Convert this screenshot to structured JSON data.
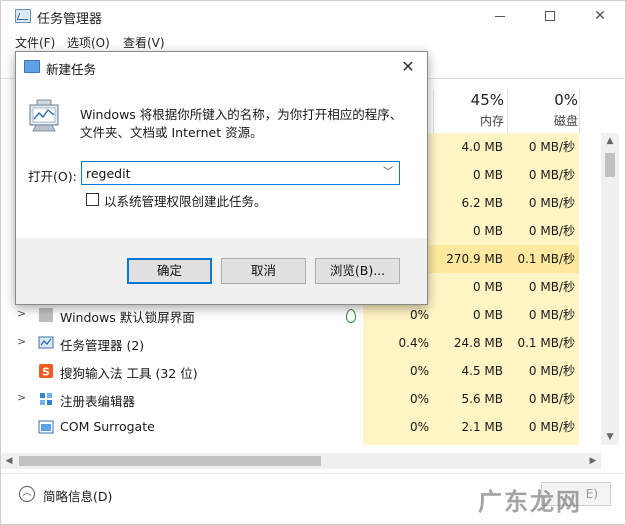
{
  "task_manager": {
    "title": "任务管理器",
    "menu": [
      "文件(F)",
      "选项(O)",
      "查看(V)"
    ],
    "columns": {
      "memory": {
        "percent": "45%",
        "label": "内存"
      },
      "disk": {
        "percent": "0%",
        "label": "磁盘"
      }
    },
    "rows": [
      {
        "name": "",
        "cpu": "",
        "mem": "4.0 MB",
        "disk": "0 MB/秒",
        "expand": false,
        "highlight": false
      },
      {
        "name": "",
        "cpu": "",
        "mem": "0 MB",
        "disk": "0 MB/秒",
        "expand": false,
        "highlight": false
      },
      {
        "name": "",
        "cpu": "",
        "mem": "6.2 MB",
        "disk": "0 MB/秒",
        "expand": false,
        "highlight": false
      },
      {
        "name": "",
        "cpu": "",
        "mem": "0 MB",
        "disk": "0 MB/秒",
        "expand": false,
        "highlight": false
      },
      {
        "name": "",
        "cpu": "",
        "mem": "270.9 MB",
        "disk": "0.1 MB/秒",
        "expand": false,
        "highlight": true
      },
      {
        "name": "",
        "cpu": "",
        "mem": "0 MB",
        "disk": "0 MB/秒",
        "expand": false,
        "highlight": false
      },
      {
        "name": "Windows 默认锁屏界面",
        "cpu": "0%",
        "mem": "0 MB",
        "disk": "0 MB/秒",
        "expand": true,
        "highlight": false,
        "icon": "gray-square-icon"
      },
      {
        "name": "任务管理器 (2)",
        "cpu": "0.4%",
        "mem": "24.8 MB",
        "disk": "0.1 MB/秒",
        "expand": true,
        "highlight": false,
        "icon": "task-manager-icon"
      },
      {
        "name": "搜狗输入法 工具 (32 位)",
        "cpu": "0%",
        "mem": "4.5 MB",
        "disk": "0 MB/秒",
        "expand": false,
        "highlight": false,
        "icon": "sogou-icon"
      },
      {
        "name": "注册表编辑器",
        "cpu": "0%",
        "mem": "5.6 MB",
        "disk": "0 MB/秒",
        "expand": true,
        "highlight": false,
        "icon": "regedit-icon"
      },
      {
        "name": "COM Surrogate",
        "cpu": "0%",
        "mem": "2.1 MB",
        "disk": "0 MB/秒",
        "expand": false,
        "highlight": false,
        "icon": "com-surrogate-icon"
      }
    ],
    "footer": {
      "details_label": "简略信息(D)",
      "end_task_label": "E)"
    }
  },
  "run_dialog": {
    "title": "新建任务",
    "description": "Windows 将根据你所键入的名称，为你打开相应的程序、文件夹、文档或 Internet 资源。",
    "open_label": "打开(O):",
    "open_value": "regedit",
    "admin_checkbox_label": "以系统管理权限创建此任务。",
    "ok_label": "确定",
    "cancel_label": "取消",
    "browse_label": "浏览(B)..."
  },
  "watermark": {
    "text": "广东龙网"
  },
  "colors": {
    "accent": "#0078d7",
    "highlight_yellow": "#fff4c4",
    "strong_yellow": "#fce89e"
  }
}
